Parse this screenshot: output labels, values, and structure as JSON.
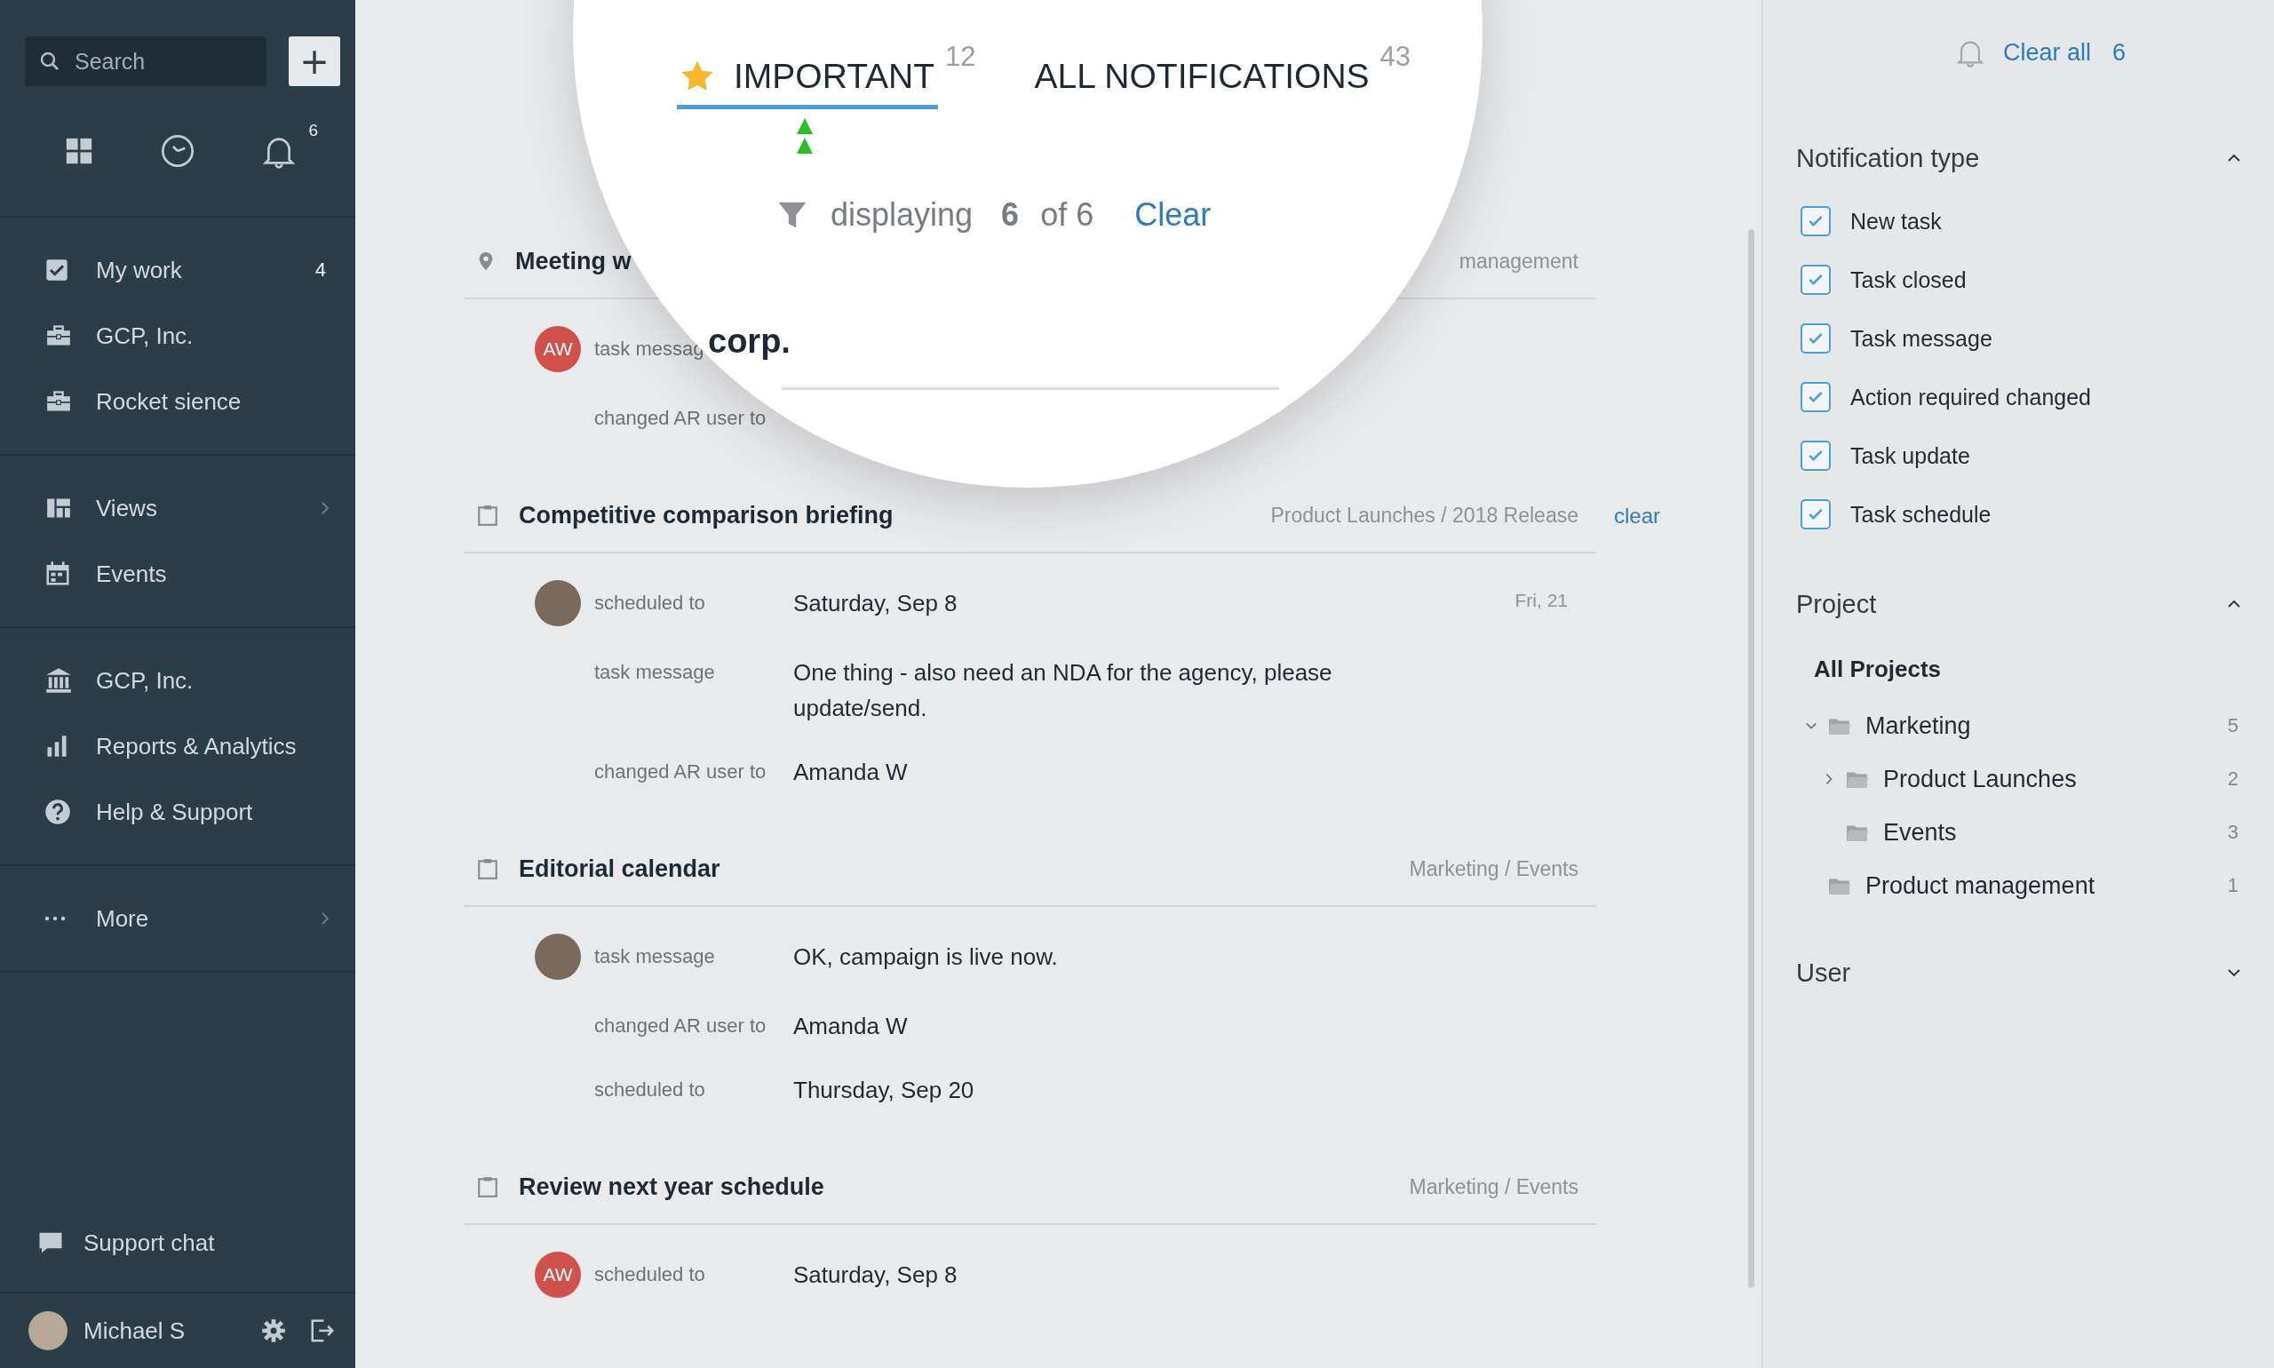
{
  "sidebar": {
    "search": {
      "placeholder": "Search"
    },
    "add_button": "+",
    "notifications_badge": "6",
    "nav_groups": [
      [
        {
          "label": "My work",
          "badge": "4",
          "has_submenu": false
        },
        {
          "label": "GCP, Inc.",
          "has_submenu": false
        },
        {
          "label": "Rocket sience",
          "has_submenu": false
        }
      ],
      [
        {
          "label": "Views",
          "has_submenu": true
        },
        {
          "label": "Events",
          "has_submenu": false
        }
      ],
      [
        {
          "label": "GCP, Inc.",
          "has_submenu": false
        },
        {
          "label": "Reports & Analytics",
          "has_submenu": false
        },
        {
          "label": "Help & Support",
          "has_submenu": false
        }
      ],
      [
        {
          "label": "More",
          "has_submenu": true
        }
      ]
    ],
    "support_chat": "Support chat",
    "user": {
      "name": "Michael S"
    }
  },
  "magnifier": {
    "tabs": [
      {
        "label": "IMPORTANT",
        "count": "12",
        "selected": true
      },
      {
        "label": "ALL NOTIFICATIONS",
        "count": "43",
        "selected": false
      }
    ],
    "filter": {
      "label": "displaying",
      "shown": "6",
      "total": "of 6",
      "clear": "Clear"
    },
    "zoomed_title": "corp."
  },
  "feed": [
    {
      "kind": "meeting",
      "title": "Meeting w",
      "path": "management",
      "entries": [
        {
          "avatar": {
            "kind": "initials",
            "text": "AW"
          },
          "rows": [
            {
              "label": "task messag"
            },
            {
              "label": "changed AR user to"
            }
          ]
        }
      ]
    },
    {
      "kind": "task",
      "title": "Competitive comparison briefing",
      "path": "Product Launches / 2018 Release",
      "clear": "clear",
      "entries": [
        {
          "avatar": {
            "kind": "photo"
          },
          "date": "Fri, 21",
          "rows": [
            {
              "label": "scheduled to",
              "value": "Saturday, Sep 8"
            },
            {
              "label": "task message",
              "value": "One thing - also need an NDA for the agency, please update/send."
            },
            {
              "label": "changed AR user to",
              "value": "Amanda W"
            }
          ]
        }
      ]
    },
    {
      "kind": "task",
      "title": "Editorial calendar",
      "path": "Marketing / Events",
      "entries": [
        {
          "avatar": {
            "kind": "photo"
          },
          "rows": [
            {
              "label": "task message",
              "value": "OK, campaign is live now."
            },
            {
              "label": "changed AR user to",
              "value": "Amanda W"
            },
            {
              "label": "scheduled to",
              "value": "Thursday, Sep 20"
            }
          ]
        }
      ]
    },
    {
      "kind": "task",
      "title": "Review next year schedule",
      "path": "Marketing / Events",
      "entries": [
        {
          "avatar": {
            "kind": "initials",
            "text": "AW"
          },
          "rows": [
            {
              "label": "scheduled to",
              "value": "Saturday, Sep 8"
            }
          ]
        }
      ]
    }
  ],
  "filters": {
    "clear_all": "Clear all",
    "count": "6",
    "sections": [
      {
        "title": "Notification type",
        "expanded": true,
        "kind": "checklist",
        "options": [
          {
            "label": "New task",
            "checked": true
          },
          {
            "label": "Task closed",
            "checked": true
          },
          {
            "label": "Task message",
            "checked": true
          },
          {
            "label": "Action required changed",
            "checked": true
          },
          {
            "label": "Task update",
            "checked": true
          },
          {
            "label": "Task schedule",
            "checked": true
          }
        ]
      },
      {
        "title": "Project",
        "expanded": true,
        "kind": "tree",
        "all": {
          "label": "All Projects",
          "selected": true
        },
        "nodes": [
          {
            "label": "Marketing",
            "count": "5",
            "kind": "branch",
            "expanded": true,
            "children": [
              {
                "label": "Product Launches",
                "count": "2",
                "kind": "branch",
                "expanded": false
              },
              {
                "label": "Events",
                "count": "3",
                "kind": "leaf"
              }
            ]
          },
          {
            "label": "Product management",
            "count": "1",
            "kind": "leaf"
          }
        ]
      },
      {
        "title": "User",
        "expanded": false
      }
    ]
  }
}
